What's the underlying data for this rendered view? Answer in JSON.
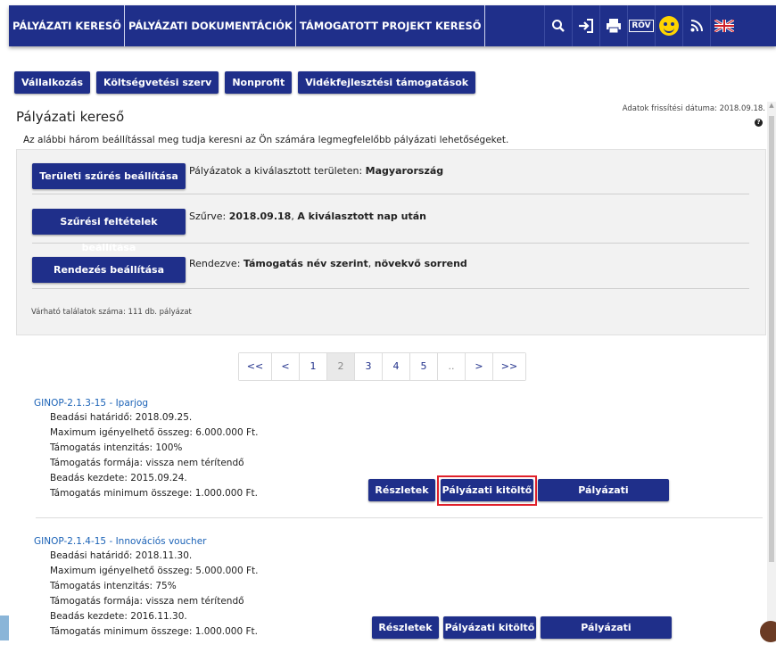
{
  "topnav": {
    "items": [
      "PÁLYÁZATI KERESŐ",
      "PÁLYÁZATI DOKUMENTÁCIÓK",
      "TÁMOGATOTT PROJEKT KERESŐ"
    ],
    "icons": [
      "search-icon",
      "login-icon",
      "print-icon",
      "rov-icon",
      "accessibility-icon",
      "rss-icon",
      "uk-flag-icon"
    ],
    "rov_label": "RÖV"
  },
  "categories": [
    "Vállalkozás",
    "Költségvetési szerv",
    "Nonprofit",
    "Vidékfejlesztési támogatások"
  ],
  "update_text": "Adatok frissítési dátuma: 2018.09.18.",
  "page_title": "Pályázati kereső",
  "intro": "Az alábbi három beállítással meg tudja keresni az Ön számára legmegfelelőbb pályázati lehetőségeket.",
  "settings": {
    "territory": {
      "button": "Területi szűrés beállítása",
      "prefix": "Pályázatok a kiválasztott területen: ",
      "value": "Magyarország"
    },
    "filter": {
      "button": "Szűrési feltételek beállítása",
      "prefix": "Szűrve: ",
      "value1": "2018.09.18",
      "mid": ", ",
      "value2": "A kiválasztott nap után"
    },
    "sort": {
      "button": "Rendezés beállítása",
      "prefix": "Rendezve: ",
      "value1": "Támogatás név szerint",
      "mid": ", ",
      "value2": "növekvő sorrend"
    },
    "results": "Várható találatok száma: 111 db. pályázat"
  },
  "pager": [
    "<<",
    "<",
    "1",
    "2",
    "3",
    "4",
    "5",
    "..",
    ">",
    ">>"
  ],
  "pager_active": "2",
  "items": [
    {
      "title": "GINOP-2.1.3-15 - Iparjog",
      "lines": [
        "Beadási határidő: 2018.09.25.",
        "Maximum igényelhető összeg: 6.000.000 Ft.",
        "Támogatás intenzitás: 100%",
        "Támogatás formája: vissza nem térítendő",
        "Beadás kezdete: 2015.09.24.",
        "Támogatás minimum összege: 1.000.000 Ft."
      ]
    },
    {
      "title": "GINOP-2.1.4-15 - Innovációs voucher",
      "lines": [
        "Beadási határidő: 2018.11.30.",
        "Maximum igényelhető összeg: 5.000.000 Ft.",
        "Támogatás intenzitás: 75%",
        "Támogatás formája: vissza nem térítendő",
        "Beadás kezdete: 2016.11.30.",
        "Támogatás minimum összege: 1.000.000 Ft."
      ]
    }
  ],
  "item_buttons": {
    "details": "Részletek",
    "form": "Pályázati kitöltő",
    "docs": "Pályázati dokumentáció"
  },
  "colors": {
    "nav_blue": "#1f2f8a",
    "link_blue": "#1c63b7",
    "highlight_red": "#e0202a"
  }
}
